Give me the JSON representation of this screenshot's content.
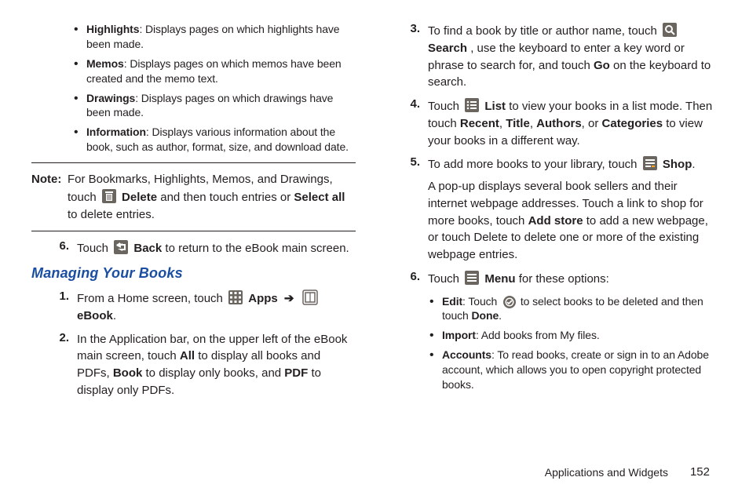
{
  "left": {
    "bullets": [
      {
        "term": "Highlights",
        "desc": ": Displays pages on which highlights have been made."
      },
      {
        "term": "Memos",
        "desc": ": Displays pages on which memos have been created and the memo text."
      },
      {
        "term": "Drawings",
        "desc": ": Displays pages on which drawings have been made."
      },
      {
        "term": "Information",
        "desc": ": Displays various information about the book, such as author, format, size, and download date."
      }
    ],
    "note": {
      "label": "Note:",
      "pre": "For Bookmarks, Highlights, Memos, and Drawings, touch ",
      "delete_b": "Delete",
      "mid": " and then touch entries or ",
      "select_all_b": "Select all",
      "post": " to delete entries."
    },
    "step6": {
      "num": "6.",
      "pre": "Touch ",
      "back_b": "Back",
      "post": " to return to the eBook main screen."
    },
    "heading": "Managing Your Books",
    "step1": {
      "num": "1.",
      "pre": "From a Home screen, touch ",
      "apps_b": "Apps",
      "arrow": "➔",
      "ebook_b": "eBook",
      "post": "."
    },
    "step2": {
      "num": "2.",
      "l1": "In the Application bar, on the upper left of the eBook main screen, touch ",
      "all_b": "All",
      "l2": " to display all books and PDFs, ",
      "book_b": "Book",
      "l3": " to display only books, and ",
      "pdf_b": "PDF",
      "l4": " to display only PDFs."
    }
  },
  "right": {
    "step3": {
      "num": "3.",
      "l1": "To find a book by title or author name, touch ",
      "search_b": "Search",
      "l2": ", use the keyboard to enter a key word or phrase to search for, and touch ",
      "go_b": "Go",
      "l3": " on the keyboard to search."
    },
    "step4": {
      "num": "4.",
      "l1": "Touch ",
      "list_b": "List",
      "l2": " to view your books in a list mode. Then touch ",
      "recent_b": "Recent",
      "c": ", ",
      "title_b": "Title",
      "authors_b": "Authors",
      "or": ", or ",
      "categories_b": "Categories",
      "l3": " to view your books in a different way."
    },
    "step5": {
      "num": "5.",
      "l1": "To add more books to your library, touch ",
      "shop_b": "Shop",
      "l2": ".",
      "p2a": "A pop-up displays several book sellers and their internet webpage addresses. Touch a link to shop for more books, touch ",
      "addstore_b": "Add store",
      "p2b": " to add a new webpage, or touch Delete to delete one or more of the existing webpage entries."
    },
    "step6": {
      "num": "6.",
      "l1": "Touch ",
      "menu_b": "Menu",
      "l2": " for these options:"
    },
    "subs": {
      "edit_term": "Edit",
      "edit_pre": ": Touch ",
      "edit_post": " to select books to be deleted and then touch ",
      "done_b": "Done",
      "edit_end": ".",
      "import_term": "Import",
      "import_desc": ": Add books from My files.",
      "accounts_term": "Accounts",
      "accounts_desc": ": To read books, create or sign in to an Adobe account, which allows you to open copyright protected books."
    }
  },
  "footer": {
    "section": "Applications and Widgets",
    "page": "152"
  }
}
